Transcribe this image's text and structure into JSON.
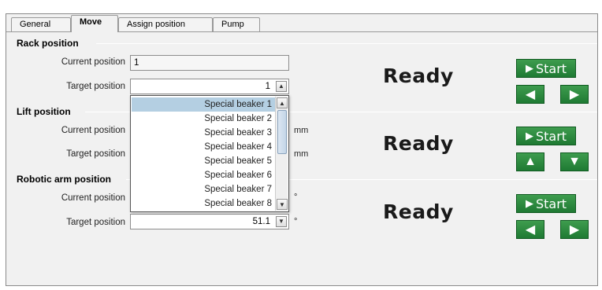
{
  "tabs": [
    {
      "label": "General"
    },
    {
      "label": "Move"
    },
    {
      "label": "Assign position"
    },
    {
      "label": "Pump"
    }
  ],
  "rack": {
    "title": "Rack position",
    "current_label": "Current position",
    "current_value": "1",
    "target_label": "Target position",
    "target_value": "1",
    "status": "Ready",
    "start_label": "Start"
  },
  "lift": {
    "title": "Lift position",
    "current_label": "Current position",
    "current_unit": "mm",
    "target_label": "Target position",
    "target_unit": "mm",
    "status": "Ready",
    "start_label": "Start"
  },
  "arm": {
    "title": "Robotic arm position",
    "current_label": "Current position",
    "current_unit": "°",
    "target_label": "Target position",
    "target_value": "51.1",
    "target_unit": "°",
    "status": "Ready",
    "start_label": "Start"
  },
  "dropdown": {
    "items": [
      "Special beaker 1",
      "Special beaker 2",
      "Special beaker 3",
      "Special beaker 4",
      "Special beaker 5",
      "Special beaker 6",
      "Special beaker 7",
      "Special beaker 8"
    ],
    "selected": "Special beaker 1"
  },
  "icons": {
    "play": "play-icon",
    "left": "arrow-left-icon",
    "right": "arrow-right-icon",
    "up": "arrow-up-icon",
    "down": "arrow-down-icon"
  },
  "colors": {
    "button_green": "#2a8a3e",
    "selection": "#b4cfe2"
  }
}
